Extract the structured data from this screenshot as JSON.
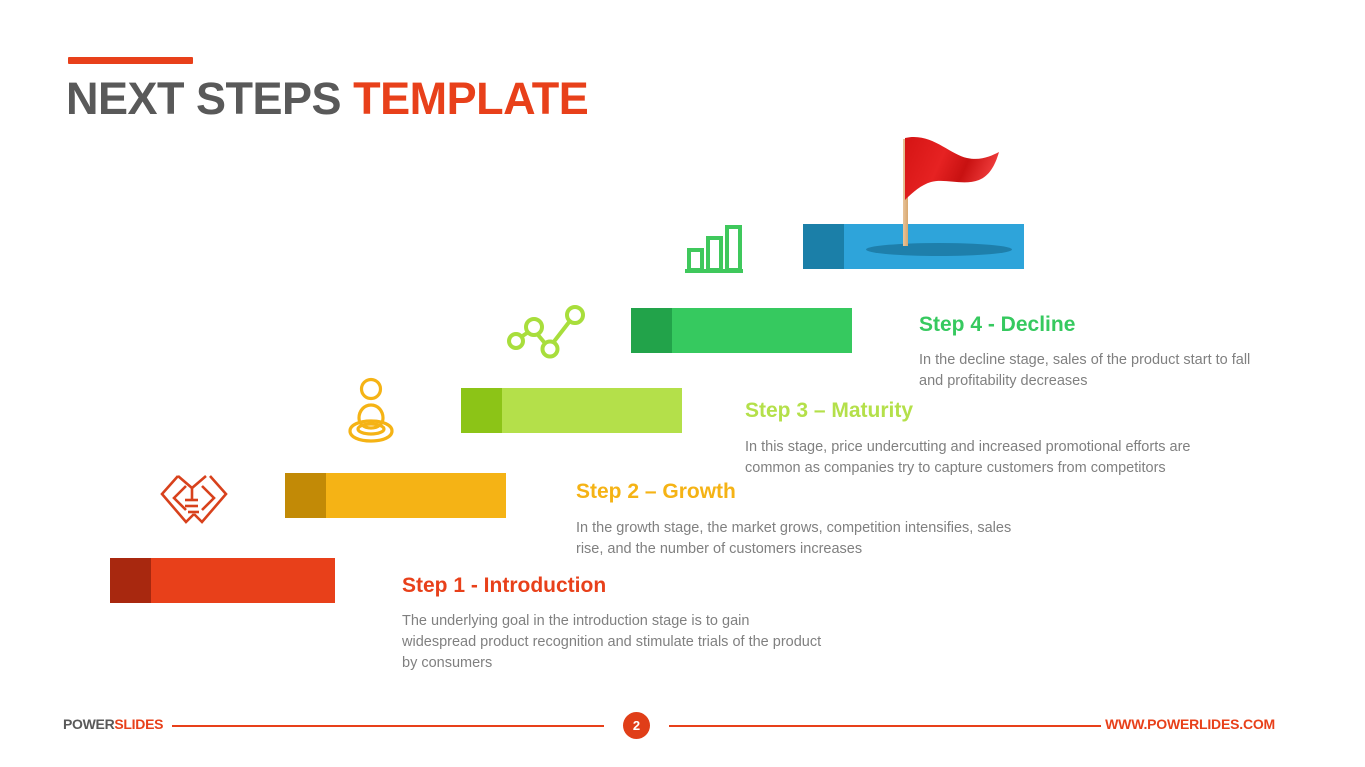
{
  "title": {
    "main": "NEXT STEPS ",
    "accent": "TEMPLATE"
  },
  "steps": [
    {
      "id": "step-1",
      "heading": "Step 1 - Introduction",
      "body": "The underlying goal in the introduction stage is to gain widespread product recognition and stimulate trials of the product by consumers",
      "icon": "handshake-icon",
      "bar_cap_color": "#A8280F",
      "bar_body_color": "#E8401A",
      "heading_color": "#E8401A"
    },
    {
      "id": "step-2",
      "heading": "Step 2 – Growth",
      "body": "In the growth stage, the market grows, competition intensifies, sales rise, and the number of customers increases",
      "icon": "person-pin-icon",
      "bar_cap_color": "#C28A06",
      "bar_body_color": "#F5B315",
      "heading_color": "#F5B315"
    },
    {
      "id": "step-3",
      "heading": "Step 3 – Maturity",
      "body": "In this stage, price undercutting and increased promotional efforts are common as companies try to capture customers from competitors",
      "icon": "line-chart-icon",
      "bar_cap_color": "#8CC417",
      "bar_body_color": "#B4E04A",
      "heading_color": "#B4E04A"
    },
    {
      "id": "step-4",
      "heading": "Step 4 - Decline",
      "body": "In the decline stage, sales of the product start to fall and profitability decreases",
      "icon": "bar-chart-icon",
      "bar_cap_color": "#22A34A",
      "bar_body_color": "#36C95F",
      "heading_color": "#36C95F"
    }
  ],
  "summit": {
    "icon": "flag-icon",
    "bar_cap_color": "#1B7FA8",
    "bar_body_color": "#2EA4DA",
    "flag_color": "#E01B1B",
    "pole_color": "#E8C49A"
  },
  "footer": {
    "logo_dark": "POWER",
    "logo_accent": "SLIDES",
    "page_number": "2",
    "url": "WWW.POWERLIDES.COM",
    "accent_color": "#E8401A"
  }
}
